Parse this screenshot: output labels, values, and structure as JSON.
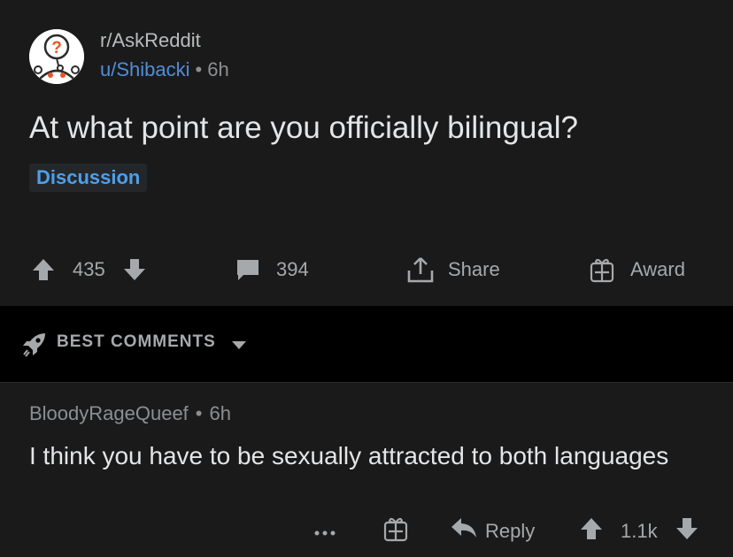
{
  "post": {
    "subreddit": "r/AskReddit",
    "author": "u/Shibacki",
    "separator": "•",
    "age": "6h",
    "title": "At what point are you officially bilingual?",
    "flair": "Discussion",
    "upvote_icon": "upvote-arrow-icon",
    "score": "435",
    "downvote_icon": "downvote-arrow-icon",
    "comments_icon": "comment-bubble-icon",
    "comment_count": "394",
    "share_icon": "share-icon",
    "share_label": "Share",
    "award_icon": "gift-icon",
    "award_label": "Award",
    "subreddit_icon": "askreddit-snoo-icon"
  },
  "sort": {
    "icon": "rocket-icon",
    "label": "BEST COMMENTS",
    "dropdown_icon": "caret-down-icon"
  },
  "comment": {
    "author": "BloodyRageQueef",
    "separator": "•",
    "age": "6h",
    "body": "I think you have to be sexually attracted to both languages",
    "more_icon": "more-dots-icon",
    "award_icon": "gift-icon",
    "reply_icon": "reply-arrow-icon",
    "reply_label": "Reply",
    "score": "1.1k"
  },
  "colors": {
    "background": "#1a1a1b",
    "sort_bar": "#000000",
    "link_blue": "#4f8fd8",
    "flair_blue": "#4f9fe8",
    "muted_text": "#a6a9ab"
  }
}
